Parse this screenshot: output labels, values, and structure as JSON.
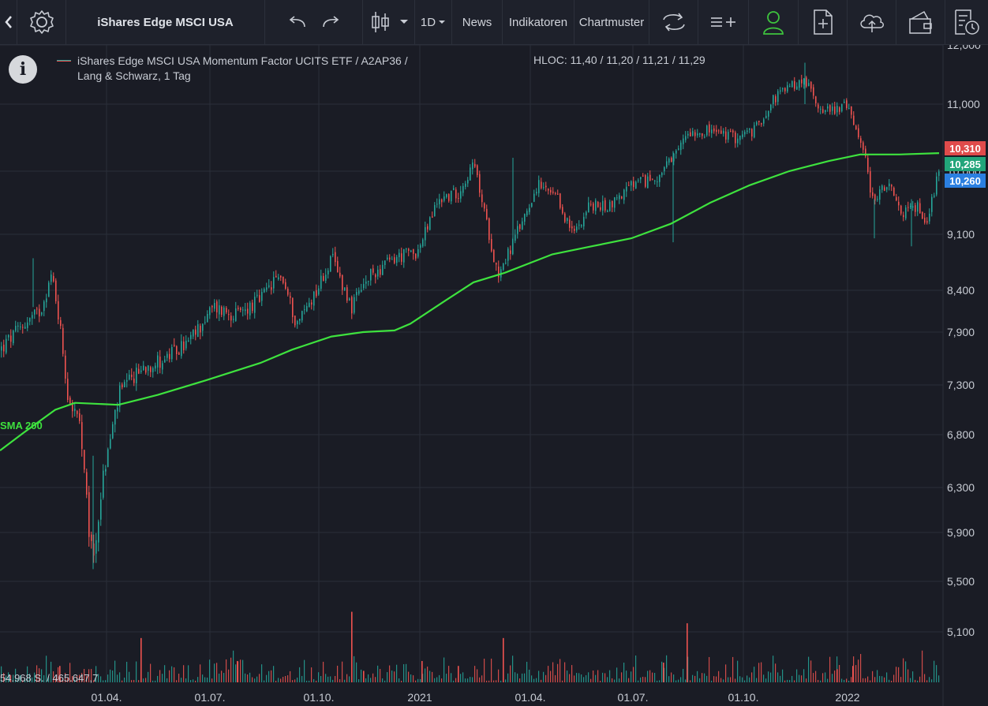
{
  "toolbar": {
    "title": "iShares Edge MSCI USA",
    "interval_label": "1D",
    "news_label": "News",
    "indicators_label": "Indikatoren",
    "patterns_label": "Chartmuster"
  },
  "chart_header": {
    "series_line1": "iShares Edge MSCI USA Momentum Factor UCITS ETF / A2AP36 /",
    "series_line2": "Lang & Schwarz, 1 Tag",
    "hloc": "HLOC: 11,40 / 11,20 / 11,21 / 11,29"
  },
  "price_boxes": [
    {
      "value": "10,310",
      "color": "#e04b4b"
    },
    {
      "value": "10,285",
      "color": "#22a57a"
    },
    {
      "value": "10,260",
      "color": "#2b7fe0"
    }
  ],
  "indicator": {
    "label": "SMA 200",
    "color": "#3ee23e"
  },
  "volume_label": "54.968 S. / 465.647,7",
  "colors": {
    "up": "#26a69a",
    "down": "#ef5350",
    "background": "#1a1c25",
    "grid": "#2a2e39"
  },
  "chart_data": {
    "type": "candlestick",
    "y_ticks": [
      "12,000",
      "11,000",
      "10,000",
      "9,100",
      "8,400",
      "7,900",
      "7,300",
      "6,800",
      "6,300",
      "5,900",
      "5,500",
      "5,100"
    ],
    "x_ticks": [
      "01.04.",
      "01.07.",
      "01.10.",
      "2021",
      "01.04.",
      "01.07.",
      "01.10.",
      "2022"
    ],
    "price_path": [
      [
        0,
        7.7
      ],
      [
        30,
        8.0
      ],
      [
        50,
        8.15
      ],
      [
        65,
        8.6
      ],
      [
        75,
        8.0
      ],
      [
        85,
        7.2
      ],
      [
        100,
        6.9
      ],
      [
        112,
        5.9
      ],
      [
        118,
        5.7
      ],
      [
        130,
        6.4
      ],
      [
        150,
        7.2
      ],
      [
        180,
        7.5
      ],
      [
        210,
        7.6
      ],
      [
        240,
        7.8
      ],
      [
        270,
        8.2
      ],
      [
        300,
        8.1
      ],
      [
        330,
        8.3
      ],
      [
        355,
        8.6
      ],
      [
        375,
        8.0
      ],
      [
        400,
        8.4
      ],
      [
        420,
        8.8
      ],
      [
        445,
        8.2
      ],
      [
        470,
        8.6
      ],
      [
        500,
        8.8
      ],
      [
        530,
        8.9
      ],
      [
        555,
        9.6
      ],
      [
        580,
        9.7
      ],
      [
        600,
        10.1
      ],
      [
        615,
        9.3
      ],
      [
        630,
        8.6
      ],
      [
        650,
        9.0
      ],
      [
        680,
        9.8
      ],
      [
        705,
        9.6
      ],
      [
        725,
        9.1
      ],
      [
        745,
        9.5
      ],
      [
        770,
        9.5
      ],
      [
        800,
        9.8
      ],
      [
        830,
        9.9
      ],
      [
        855,
        10.2
      ],
      [
        870,
        10.6
      ],
      [
        900,
        10.6
      ],
      [
        930,
        10.5
      ],
      [
        955,
        10.6
      ],
      [
        980,
        11.1
      ],
      [
        1000,
        11.3
      ],
      [
        1020,
        11.4
      ],
      [
        1035,
        11.0
      ],
      [
        1050,
        10.9
      ],
      [
        1070,
        11.0
      ],
      [
        1090,
        10.5
      ],
      [
        1105,
        9.6
      ],
      [
        1125,
        9.8
      ],
      [
        1140,
        9.4
      ],
      [
        1160,
        9.5
      ],
      [
        1175,
        9.3
      ],
      [
        1190,
        10.1
      ]
    ],
    "sma_path": [
      [
        0,
        6.65
      ],
      [
        30,
        6.82
      ],
      [
        70,
        7.05
      ],
      [
        95,
        7.12
      ],
      [
        150,
        7.1
      ],
      [
        200,
        7.2
      ],
      [
        260,
        7.35
      ],
      [
        330,
        7.55
      ],
      [
        370,
        7.7
      ],
      [
        420,
        7.85
      ],
      [
        460,
        7.9
      ],
      [
        500,
        7.92
      ],
      [
        520,
        8.0
      ],
      [
        560,
        8.25
      ],
      [
        600,
        8.5
      ],
      [
        640,
        8.62
      ],
      [
        700,
        8.85
      ],
      [
        750,
        8.95
      ],
      [
        800,
        9.05
      ],
      [
        850,
        9.25
      ],
      [
        900,
        9.55
      ],
      [
        950,
        9.8
      ],
      [
        1000,
        10.0
      ],
      [
        1050,
        10.15
      ],
      [
        1090,
        10.25
      ],
      [
        1140,
        10.25
      ],
      [
        1190,
        10.27
      ]
    ],
    "volume_spikes": [
      [
        75,
        0.1
      ],
      [
        178,
        0.27
      ],
      [
        300,
        0.13
      ],
      [
        445,
        0.43
      ],
      [
        460,
        0.07
      ],
      [
        534,
        0.13
      ],
      [
        580,
        0.1
      ],
      [
        637,
        0.27
      ],
      [
        840,
        0.12
      ],
      [
        870,
        0.36
      ],
      [
        1060,
        0.08
      ],
      [
        1080,
        0.1
      ]
    ]
  }
}
